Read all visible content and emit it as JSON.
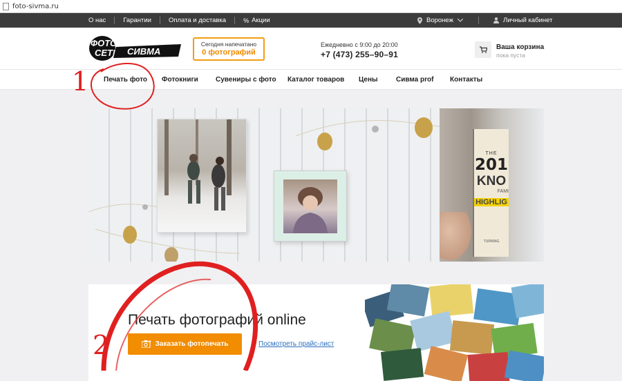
{
  "browser": {
    "url": "foto-sivma.ru"
  },
  "topbar": {
    "links": [
      "О нас",
      "Гарантии",
      "Оплата и доставка",
      "Акции"
    ],
    "city": "Воронеж",
    "cabinet": "Личный кабинет"
  },
  "header": {
    "logo_line1": "ФОТО",
    "logo_line2": "СЕТЬ",
    "logo_brand": "СИВМА",
    "printed_label": "Сегодня напечатано",
    "printed_count": "0 фотографий",
    "hours": "Ежедневно с 9:00 до 20:00",
    "phone": "+7 (473) 255–90–91",
    "cart_title": "Ваша корзина",
    "cart_status": "пока пуста"
  },
  "nav": {
    "items": [
      "Печать фото",
      "Фотокниги",
      "Сувениры с фото",
      "Каталог товаров",
      "Цены",
      "Сивма prof",
      "Контакты"
    ]
  },
  "hero": {
    "book_year": "201",
    "book_word": "KNO",
    "book_tag": "HIGHLIG",
    "book_prefix": "THE",
    "book_fami": "FAMI",
    "book_turning": "TURNING"
  },
  "main": {
    "title": "Печать фотографий online",
    "order_button": "Заказать фотопечать",
    "price_link": "Посмотреть прайс-лист"
  },
  "annotations": {
    "one": "1",
    "two": "2"
  },
  "colors": {
    "accent": "#f28c00",
    "topbar": "#3c3c3c",
    "annotation": "#e02020",
    "link": "#2a6fbf"
  }
}
